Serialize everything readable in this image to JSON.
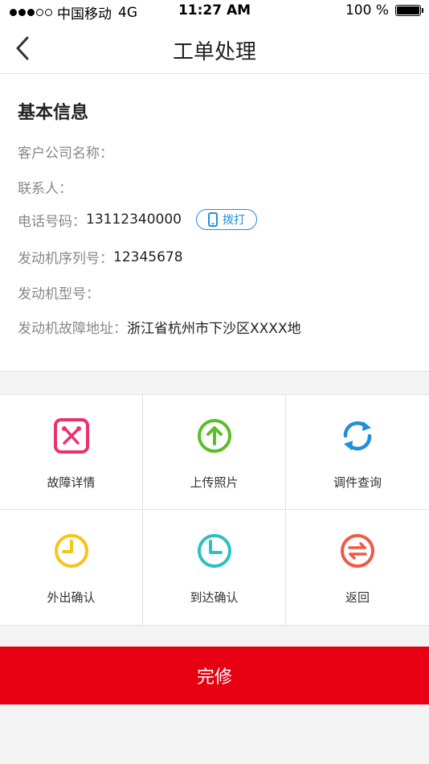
{
  "status_bar": {
    "carrier": "中国移动",
    "network": "4G",
    "time": "11:27 AM",
    "battery": "100 %",
    "battery_level": 1.0
  },
  "nav": {
    "back_icon": "chevron-left-icon",
    "title": "工单处理"
  },
  "info": {
    "section_title": "基本信息",
    "rows": [
      {
        "label": "客户公司名称：",
        "value": ""
      },
      {
        "label": "联系人：",
        "value": ""
      },
      {
        "label": "电话号码：",
        "value": "13112340000"
      },
      {
        "label": "发动机序列号：",
        "value": "12345678"
      },
      {
        "label": "发动机型号：",
        "value": ""
      },
      {
        "label": "发动机故障地址：",
        "value": "浙江省杭州市下沙区XXXX地"
      }
    ],
    "call_button": {
      "label": "拨打",
      "icon": "phone-icon",
      "color": "#1e8fe1"
    }
  },
  "actions": [
    {
      "label": "故障详情",
      "icon": "tools-icon",
      "color": "#e8336d"
    },
    {
      "label": "上传照片",
      "icon": "upload-arrow-icon",
      "color": "#5bbd2b"
    },
    {
      "label": "调件查询",
      "icon": "refresh-icon",
      "color": "#1f8edb"
    },
    {
      "label": "外出确认",
      "icon": "clock-icon",
      "color": "#f5c518"
    },
    {
      "label": "到达确认",
      "icon": "clock-icon",
      "color": "#2cc1c4"
    },
    {
      "label": "返回",
      "icon": "swap-arrows-icon",
      "color": "#ef5a43"
    }
  ],
  "complete_button": {
    "label": "完修",
    "color": "#e60012"
  }
}
